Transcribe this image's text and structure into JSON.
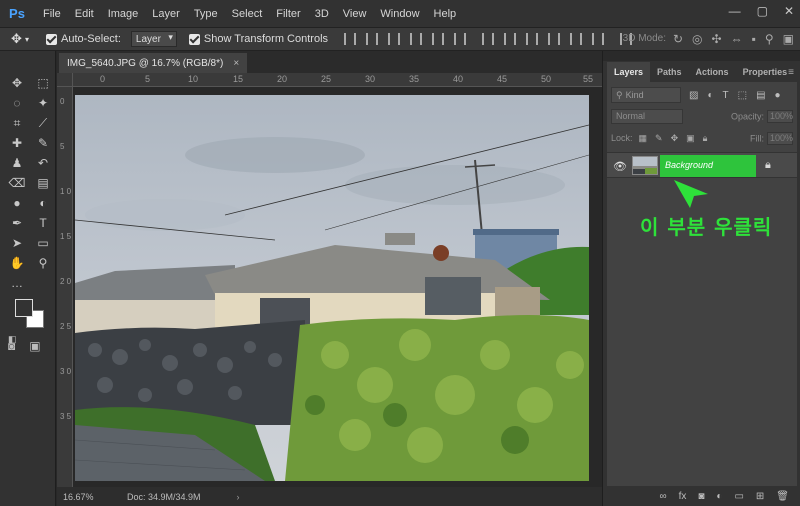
{
  "app": {
    "logo": "Ps",
    "menu": [
      "File",
      "Edit",
      "Image",
      "Layer",
      "Type",
      "Select",
      "Filter",
      "3D",
      "View",
      "Window",
      "Help"
    ],
    "window_controls": [
      "—",
      "▢",
      "✕"
    ]
  },
  "options_bar": {
    "auto_select_label": "Auto-Select:",
    "auto_select_value": "Layer",
    "show_transform_label": "Show Transform Controls",
    "mode3d_label": "3D Mode:"
  },
  "document": {
    "tab_title": "IMG_5640.JPG @ 16.7% (RGB/8*)",
    "tab_close": "×",
    "ruler_h": [
      "0",
      "5",
      "10",
      "15",
      "20",
      "25",
      "30",
      "35",
      "40",
      "45",
      "50",
      "55"
    ],
    "ruler_v": [
      "0",
      "5",
      "1 0",
      "1 5",
      "2 0",
      "2 5",
      "3 0",
      "3 5"
    ]
  },
  "status": {
    "zoom": "16.67%",
    "doc_info": "Doc: 34.9M/34.9M",
    "arrow": "›"
  },
  "layers_panel": {
    "tabs": [
      "Layers",
      "Paths",
      "Actions",
      "Properties"
    ],
    "active_tab": "Layers",
    "kind_label": "Kind",
    "blend_mode": "Normal",
    "opacity_label": "Opacity:",
    "opacity_value": "100%",
    "lock_label": "Lock:",
    "fill_label": "Fill:",
    "fill_value": "100%",
    "layers": [
      {
        "name": "Background",
        "locked": true,
        "visible": true
      }
    ]
  },
  "annotation": {
    "text": "이 부분 우클릭",
    "color": "#2ee23a"
  },
  "colors": {
    "accent_green": "#2ec43c",
    "ui_dark": "#323232",
    "panel_body": "#424242"
  }
}
